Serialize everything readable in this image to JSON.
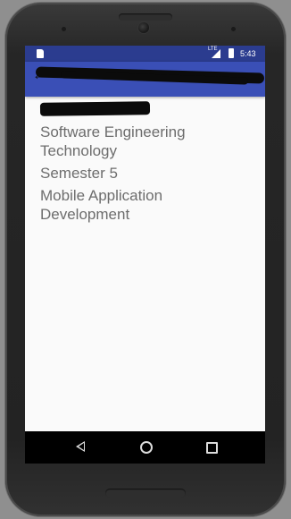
{
  "status_bar": {
    "network_label": "LTE",
    "time": "5:43"
  },
  "content": {
    "lines": [
      "Software Engineering Technology",
      "Semester 5",
      "Mobile Application Development"
    ]
  },
  "colors": {
    "primary": "#3a4fb6",
    "primary_dark": "#2b3c8f",
    "text": "#6d6d6d",
    "background": "#fafafa"
  },
  "icons": [
    "sd-card-icon",
    "signal-icon",
    "battery-icon",
    "back-arrow-icon",
    "nav-back-icon",
    "nav-home-icon",
    "nav-recents-icon"
  ]
}
